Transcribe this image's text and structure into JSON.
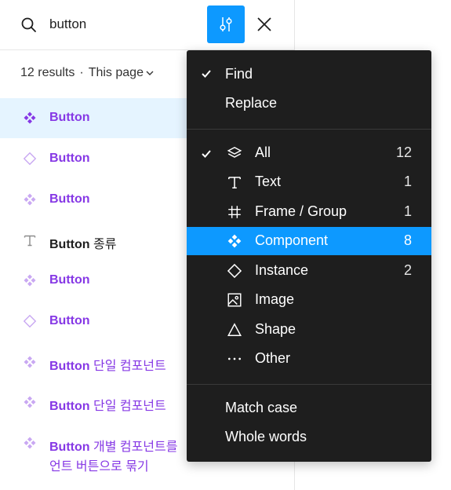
{
  "search": {
    "query": "button"
  },
  "results_header": {
    "count": "12 results",
    "separator": "·",
    "scope": "This page"
  },
  "results": [
    {
      "label": "Button",
      "rest": "",
      "icon": "component-icon",
      "selected": true
    },
    {
      "label": "Button",
      "rest": "",
      "icon": "instance-icon"
    },
    {
      "label": "Button",
      "rest": "",
      "icon": "component-icon"
    },
    {
      "label": "Button",
      "rest": " 종류",
      "icon": "text-icon"
    },
    {
      "label": "Button",
      "rest": "",
      "icon": "component-icon"
    },
    {
      "label": "Button",
      "rest": "",
      "icon": "instance-icon"
    },
    {
      "label": "Button",
      "rest": " 단일 컴포넌트",
      "icon": "component-icon"
    },
    {
      "label": "Button",
      "rest": " 단일 컴포넌트",
      "icon": "component-icon"
    },
    {
      "label": "Button",
      "rest": " 개별 컴포넌트를",
      "line2": "언트 버튼으로 묶기",
      "icon": "component-icon"
    }
  ],
  "menu": {
    "find": "Find",
    "replace": "Replace",
    "types": [
      {
        "label": "All",
        "count": "12",
        "icon": "layers-icon",
        "checked": true
      },
      {
        "label": "Text",
        "count": "1",
        "icon": "text-icon"
      },
      {
        "label": "Frame / Group",
        "count": "1",
        "icon": "frame-icon"
      },
      {
        "label": "Component",
        "count": "8",
        "icon": "component-icon",
        "highlighted": true
      },
      {
        "label": "Instance",
        "count": "2",
        "icon": "instance-icon"
      },
      {
        "label": "Image",
        "count": "",
        "icon": "image-icon"
      },
      {
        "label": "Shape",
        "count": "",
        "icon": "shape-icon"
      },
      {
        "label": "Other",
        "count": "",
        "icon": "more-icon"
      }
    ],
    "match_case": "Match case",
    "whole_words": "Whole words"
  },
  "colors": {
    "accent": "#0d99ff",
    "component_purple": "#8638e5",
    "menu_bg": "#1e1e1e",
    "selected_row": "#e5f4ff"
  }
}
